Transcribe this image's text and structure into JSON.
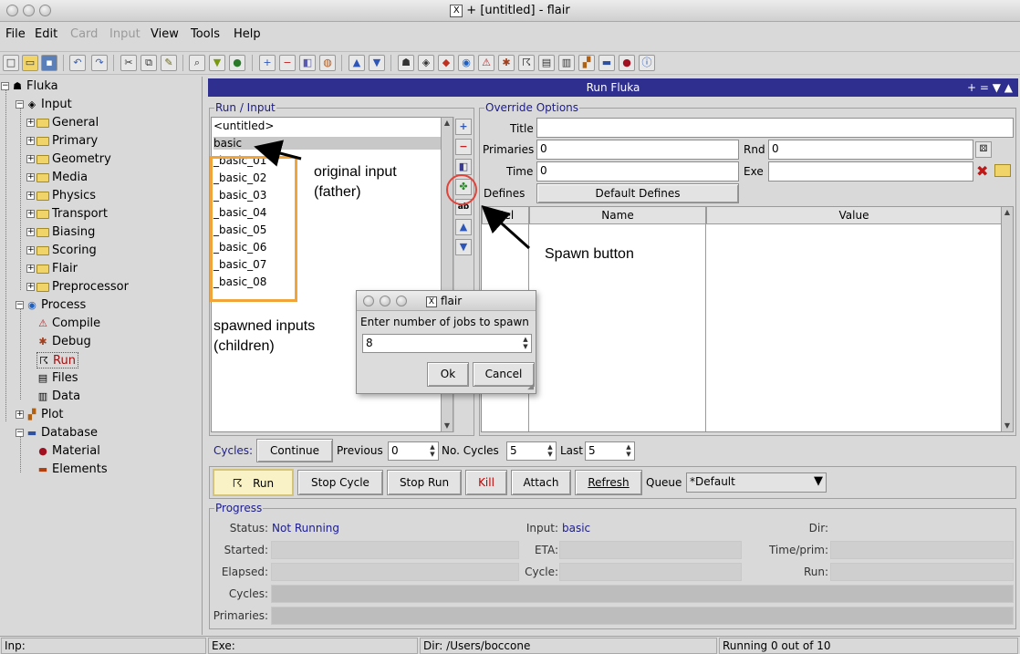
{
  "window": {
    "title": "+ [untitled] - flair",
    "x_logo": "X"
  },
  "menu": [
    "File",
    "Edit",
    "Card",
    "Input",
    "View",
    "Tools",
    "Help"
  ],
  "menu_disabled": [
    "Card",
    "Input"
  ],
  "tree": {
    "root": "Fluka",
    "input": "Input",
    "input_children": [
      "General",
      "Primary",
      "Geometry",
      "Media",
      "Physics",
      "Transport",
      "Biasing",
      "Scoring",
      "Flair",
      "Preprocessor"
    ],
    "process": "Process",
    "process_children": [
      "Compile",
      "Debug",
      "Run",
      "Files",
      "Data"
    ],
    "plot": "Plot",
    "database": "Database",
    "database_children": [
      "Material",
      "Elements"
    ]
  },
  "panel_title": "Run Fluka",
  "panel_controls": "+ = ▼ ▲",
  "run_input": {
    "label": "Run / Input",
    "items": [
      "<untitled>",
      "basic",
      "_basic_01",
      "_basic_02",
      "_basic_03",
      "_basic_04",
      "_basic_05",
      "_basic_06",
      "_basic_07",
      "_basic_08"
    ],
    "selected": "basic"
  },
  "override": {
    "label": "Override Options",
    "title_label": "Title",
    "title_value": "",
    "primaries_label": "Primaries",
    "primaries_value": "0",
    "rnd_label": "Rnd",
    "rnd_value": "0",
    "time_label": "Time",
    "time_value": "0",
    "exe_label": "Exe",
    "exe_value": "",
    "defines_label": "Defines",
    "default_defines_button": "Default Defines",
    "columns": [
      "Sel",
      "Name",
      "Value"
    ]
  },
  "annotations": {
    "original_input": "original input",
    "father": "(father)",
    "spawned_inputs": "spawned inputs",
    "children": "(children)",
    "spawn_button": "Spawn button"
  },
  "dialog": {
    "title": "flair",
    "x_logo": "X",
    "prompt": "Enter number of jobs to spawn",
    "value": "8",
    "ok": "Ok",
    "cancel": "Cancel"
  },
  "cycles": {
    "label": "Cycles:",
    "continue": "Continue",
    "previous_label": "Previous",
    "previous_value": "0",
    "no_cycles_label": "No. Cycles",
    "no_cycles_value": "5",
    "last_label": "Last",
    "last_value": "5"
  },
  "actions": {
    "run": "Run",
    "stop_cycle": "Stop Cycle",
    "stop_run": "Stop Run",
    "kill": "Kill",
    "attach": "Attach",
    "refresh": "Refresh",
    "queue_label": "Queue",
    "queue_value": "*Default"
  },
  "progress": {
    "label": "Progress",
    "status_label": "Status:",
    "status_value": "Not Running",
    "input_label": "Input:",
    "input_value": "basic",
    "dir_label": "Dir:",
    "started_label": "Started:",
    "eta_label": "ETA:",
    "timeprim_label": "Time/prim:",
    "elapsed_label": "Elapsed:",
    "cycle_label": "Cycle:",
    "run_label": "Run:",
    "cycles_label": "Cycles:",
    "primaries_label": "Primaries:"
  },
  "statusbar": {
    "inp": "Inp:",
    "exe": "Exe:",
    "dir": "Dir: /Users/boccone",
    "running": "Running 0 out of 10"
  },
  "colors": {
    "panel_title_bg": "#2f2f8f",
    "group_label": "#1c1c8c",
    "annotation_box": "#f0a43a",
    "annotation_circle": "#e0443a",
    "kill": "#c00000"
  }
}
